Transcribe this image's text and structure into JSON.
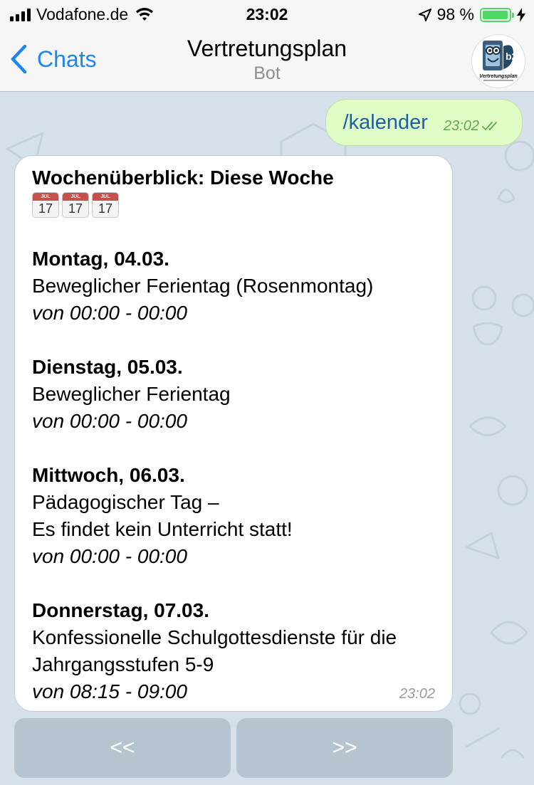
{
  "status_bar": {
    "carrier": "Vodafone.de",
    "time": "23:02",
    "battery_percent": "98 %",
    "battery_level": 0.98
  },
  "nav": {
    "back_label": "Chats",
    "title": "Vertretungsplan",
    "subtitle": "Bot",
    "avatar_text": "Vertretungsplan"
  },
  "outgoing": {
    "text": "/kalender",
    "time": "23:02"
  },
  "incoming": {
    "heading": "Wochenüberblick: Diese Woche",
    "calendar_icons": [
      {
        "month": "JUL",
        "day": "17"
      },
      {
        "month": "JUL",
        "day": "17"
      },
      {
        "month": "JUL",
        "day": "17"
      }
    ],
    "days": [
      {
        "title": "Montag, 04.03.",
        "lines": [
          "Beweglicher Ferientag (Rosenmontag)"
        ],
        "time": "von 00:00 - 00:00"
      },
      {
        "title": "Dienstag, 05.03.",
        "lines": [
          "Beweglicher Ferientag"
        ],
        "time": "von 00:00 - 00:00"
      },
      {
        "title": "Mittwoch, 06.03.",
        "lines": [
          "Pädagogischer Tag –",
          "Es findet kein Unterricht statt!"
        ],
        "time": "von 00:00 - 00:00"
      },
      {
        "title": "Donnerstag, 07.03.",
        "lines": [
          "Konfessionelle Schulgottesdienste für die",
          "Jahrgangsstufen 5-9"
        ],
        "time": "von 08:15 - 09:00"
      }
    ],
    "time": "23:02"
  },
  "keyboard": {
    "prev_label": "<<",
    "next_label": ">>"
  },
  "colors": {
    "accent": "#1c86ee",
    "outgoing_bubble": "#e1fdc6",
    "wallpaper": "#d5e0ea",
    "battery": "#4cd964"
  }
}
